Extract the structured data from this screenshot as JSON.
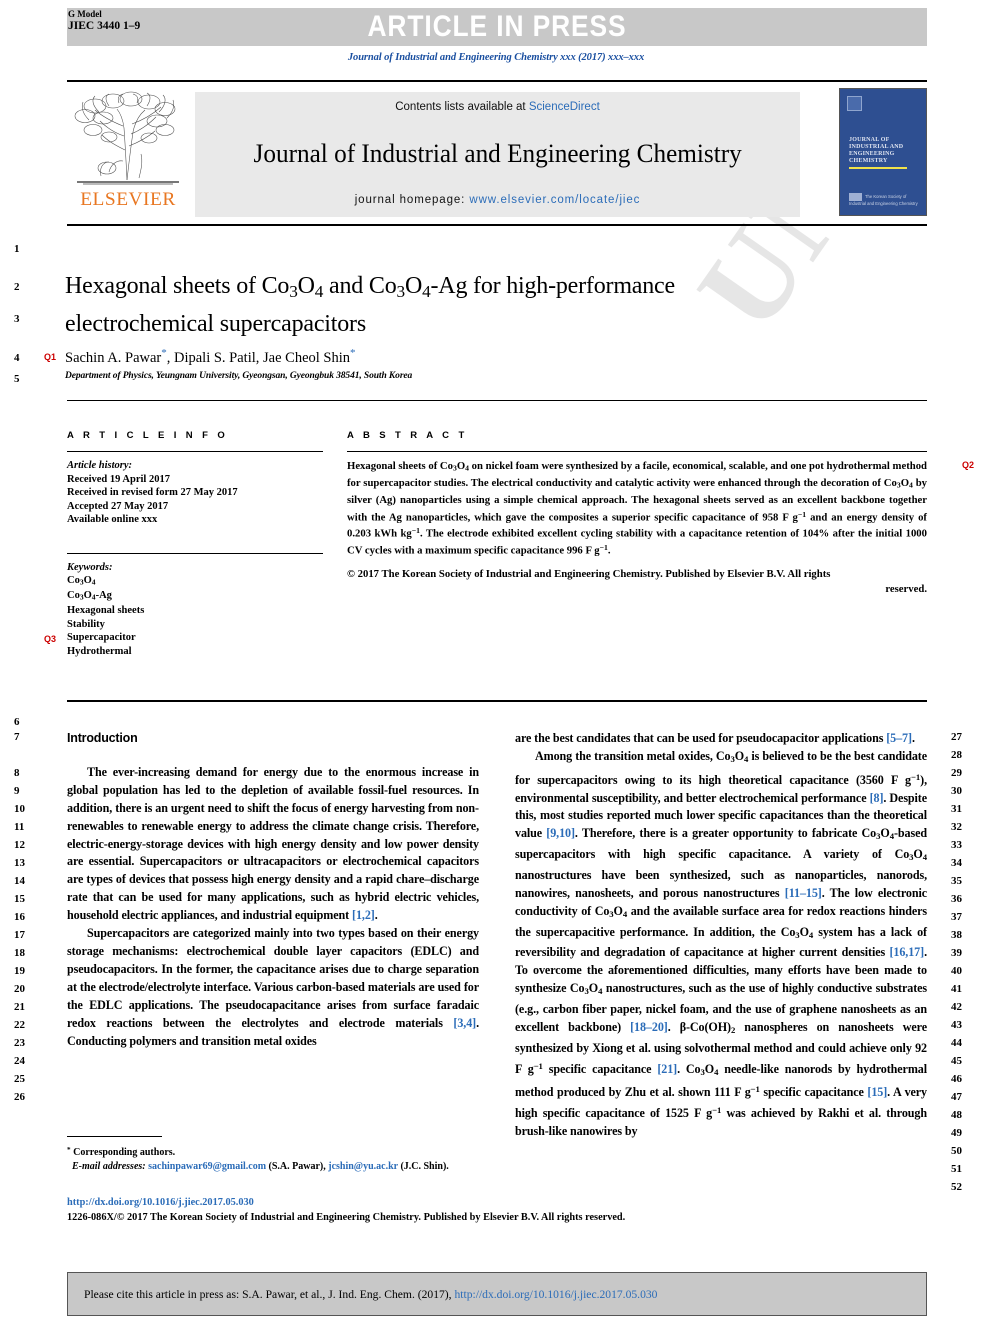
{
  "header": {
    "g_model_label": "G Model",
    "article_id": "JIEC 3440 1–9",
    "status_banner": "ARTICLE IN PRESS",
    "journal_citation_line": "Journal of Industrial and Engineering Chemistry xxx (2017) xxx–xxx"
  },
  "masthead": {
    "contents_prefix": "Contents lists available at ",
    "contents_link": "ScienceDirect",
    "journal_title": "Journal of Industrial and Engineering Chemistry",
    "homepage_label": "journal homepage: ",
    "homepage_url": "www.elsevier.com/locate/jiec",
    "publisher_logo_word": "ELSEVIER",
    "cover_title": "JOURNAL OF INDUSTRIAL AND ENGINEERING CHEMISTRY",
    "cover_footer": "The Korean Society of Industrial and Engineering Chemistry"
  },
  "article": {
    "title": "Hexagonal sheets of Co3O4 and Co3O4-Ag for high-performance electrochemical supercapacitors",
    "authors": "Sachin A. Pawar, Dipali S. Patil, Jae Cheol Shin",
    "affiliation": "Department of Physics, Yeungnam University, Gyeongsan, Gyeongbuk 38541, South Korea",
    "query_tags": {
      "q1": "Q1",
      "q2": "Q2",
      "q3": "Q3"
    }
  },
  "article_info": {
    "heading": "A R T I C L E   I N F O",
    "history_label": "Article history:",
    "history": [
      "Received 19 April 2017",
      "Received in revised form 27 May 2017",
      "Accepted 27 May 2017",
      "Available online xxx"
    ],
    "keywords_label": "Keywords:",
    "keywords": [
      "Co3O4",
      "Co3O4-Ag",
      "Hexagonal sheets",
      "Stability",
      "Supercapacitor",
      "Hydrothermal"
    ]
  },
  "abstract": {
    "heading": "A B S T R A C T",
    "body": "Hexagonal sheets of Co3O4 on nickel foam were synthesized by a facile, economical, scalable, and one pot hydrothermal method for supercapacitor studies. The electrical conductivity and catalytic activity were enhanced through the decoration of Co3O4 by silver (Ag) nanoparticles using a simple chemical approach. The hexagonal sheets served as an excellent backbone together with the Ag nanoparticles, which gave the composites a superior specific capacitance of 958 F g−1 and an energy density of 0.203 kWh kg−1. The electrode exhibited excellent cycling stability with a capacitance retention of 104% after the initial 1000 CV cycles with a maximum specific capacitance 996 F g−1.",
    "copyright": "© 2017 The Korean Society of Industrial and Engineering Chemistry. Published by Elsevier B.V. All rights",
    "copyright_tail": "reserved."
  },
  "body": {
    "section_heading": "Introduction",
    "left_paragraphs": [
      "The ever-increasing demand for energy due to the enormous increase in global population has led to the depletion of available fossil-fuel resources. In addition, there is an urgent need to shift the focus of energy harvesting from non-renewables to renewable energy to address the climate change crisis. Therefore, electric-energy-storage devices with high energy density and low power density are essential. Supercapacitors or ultracapacitors or electrochemical capacitors are types of devices that possess high energy density and a rapid chare–discharge rate that can be used for many applications, such as hybrid electric vehicles, household electric appliances, and industrial equipment [1,2].",
      "Supercapacitors are categorized mainly into two types based on their energy storage mechanisms: electrochemical double layer capacitors (EDLC) and pseudocapacitors. In the former, the capacitance arises due to charge separation at the electrode/electrolyte interface. Various carbon-based materials are used for the EDLC applications. The pseudocapacitance arises from surface faradaic redox reactions between the electrolytes and electrode materials [3,4]. Conducting polymers and transition metal oxides"
    ],
    "right_paragraphs": [
      "are the best candidates that can be used for pseudocapacitor applications [5–7].",
      "Among the transition metal oxides, Co3O4 is believed to be the best candidate for supercapacitors owing to its high theoretical capacitance (3560 F g−1), environmental susceptibility, and better electrochemical performance [8]. Despite this, most studies reported much lower specific capacitances than the theoretical value [9,10]. Therefore, there is a greater opportunity to fabricate Co3O4-based supercapacitors with high specific capacitance. A variety of Co3O4 nanostructures have been synthesized, such as nanoparticles, nanorods, nanowires, nanosheets, and porous nanostructures [11–15]. The low electronic conductivity of Co3O4 and the available surface area for redox reactions hinders the supercapacitive performance. In addition, the Co3O4 system has a lack of reversibility and degradation of capacitance at higher current densities [16,17]. To overcome the aforementioned difficulties, many efforts have been made to synthesize Co3O4 nanostructures, such as the use of highly conductive substrates (e.g., carbon fiber paper, nickel foam, and the use of graphene nanosheets as an excellent backbone) [18–20]. β-Co(OH)2 nanospheres on nanosheets were synthesized by Xiong et al. using solvothermal method and could achieve only 92 F g−1 specific capacitance [21]. Co3O4 needle-like nanorods by hydrothermal method produced by Zhu et al. shown 111 F g−1 specific capacitance [15]. A very high specific capacitance of 1525 F g−1 was achieved by Rakhi et al. through brush-like nanowires by"
    ]
  },
  "footnote": {
    "corresponding": "Corresponding authors.",
    "email_label": "E-mail addresses:",
    "email1": "sachinpawar69@gmail.com",
    "email1_owner": "(S.A. Pawar),",
    "email2": "jcshin@yu.ac.kr",
    "email2_owner": "(J.C. Shin)."
  },
  "doi_block": {
    "doi_url": "http://dx.doi.org/10.1016/j.jiec.2017.05.030",
    "issn_line": "1226-086X/© 2017 The Korean Society of Industrial and Engineering Chemistry. Published by Elsevier B.V. All rights reserved."
  },
  "citation_footer": {
    "text": "Please cite this article in press as: S.A. Pawar, et al., J. Ind. Eng. Chem. (2017), ",
    "link": "http://dx.doi.org/10.1016/j.jiec.2017.05.030"
  },
  "line_numbers": {
    "left": [
      "1",
      "2",
      "3",
      "4",
      "5",
      "6",
      "7",
      "8",
      "9",
      "10",
      "11",
      "12",
      "13",
      "14",
      "15",
      "16",
      "17",
      "18",
      "19",
      "20",
      "21",
      "22",
      "23",
      "24",
      "25",
      "26"
    ],
    "right": [
      "27",
      "28",
      "29",
      "30",
      "31",
      "32",
      "33",
      "34",
      "35",
      "36",
      "37",
      "38",
      "39",
      "40",
      "41",
      "42",
      "43",
      "44",
      "45",
      "46",
      "47",
      "48",
      "49",
      "50",
      "51",
      "52"
    ]
  },
  "watermark_text": "UNCORRECTED PROOF",
  "colors": {
    "link": "#2b6cb8",
    "query_tag": "#cc0000",
    "banner_bg": "#c8c8c8",
    "elsevier_orange": "#e87722",
    "cover_blue": "#2e4f91"
  }
}
